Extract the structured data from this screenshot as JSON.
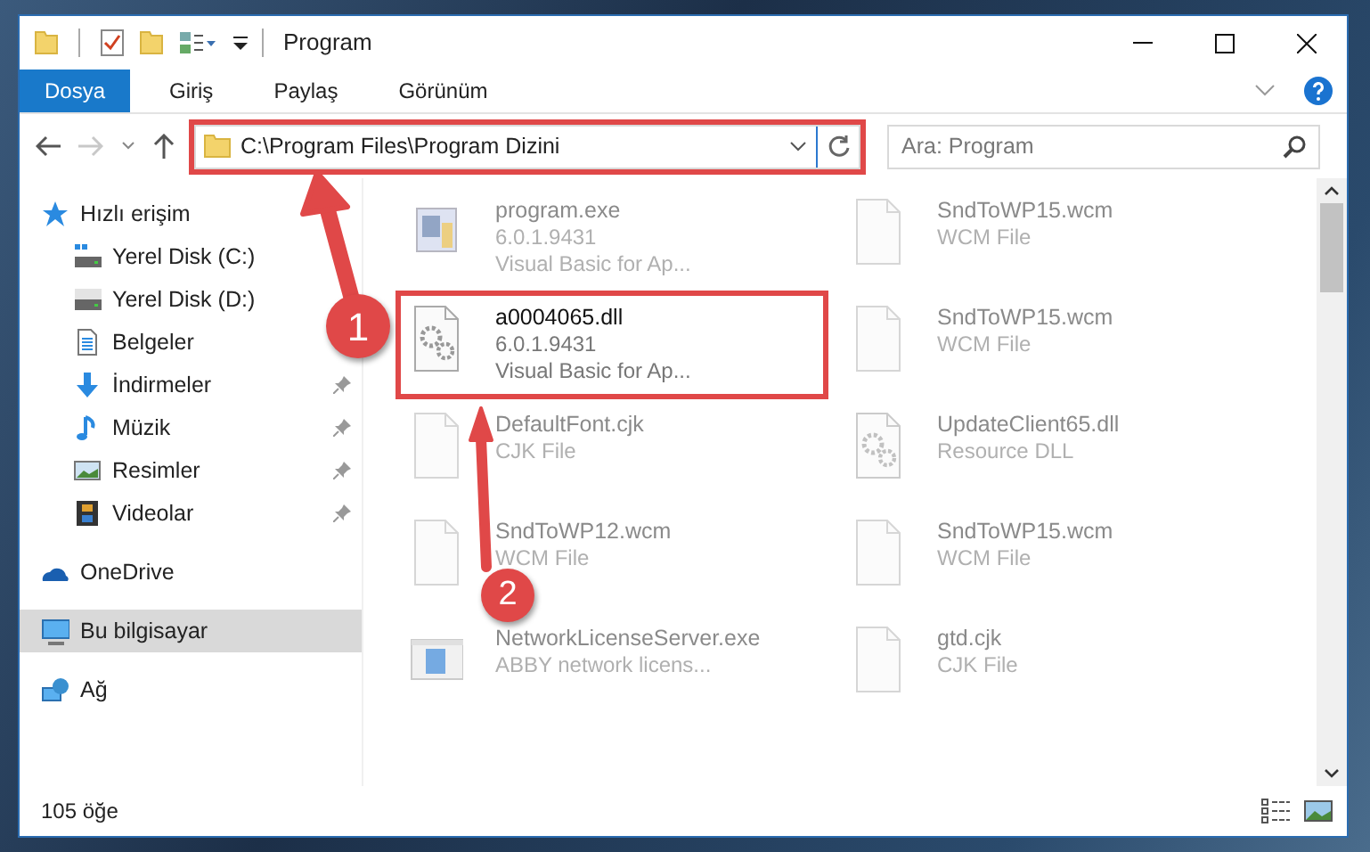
{
  "window": {
    "title": "Program"
  },
  "ribbon_tabs": [
    {
      "label": "Dosya",
      "selected": true
    },
    {
      "label": "Giriş",
      "selected": false
    },
    {
      "label": "Paylaş",
      "selected": false
    },
    {
      "label": "Görünüm",
      "selected": false
    }
  ],
  "address": {
    "path": "C:\\Program Files\\Program Dizini",
    "highlighted": true
  },
  "search": {
    "placeholder": "Ara: Program"
  },
  "sidebar": {
    "items": [
      {
        "label": "Hızlı erişim",
        "kind": "star",
        "selected": false,
        "children": [
          {
            "label": "Yerel Disk (C:)",
            "kind": "drive-c",
            "selected": false
          },
          {
            "label": "Yerel Disk (D:)",
            "kind": "drive",
            "selected": false
          },
          {
            "label": "Belgeler",
            "kind": "document",
            "selected": false
          },
          {
            "label": "İndirmeler",
            "kind": "download",
            "pinned": true,
            "selected": false
          },
          {
            "label": "Müzik",
            "kind": "music",
            "pinned": true,
            "selected": false
          },
          {
            "label": "Resimler",
            "kind": "pictures",
            "pinned": true,
            "selected": false
          },
          {
            "label": "Videolar",
            "kind": "video",
            "pinned": true,
            "selected": false
          }
        ]
      },
      {
        "label": "OneDrive",
        "kind": "cloud",
        "selected": false
      },
      {
        "label": "Bu bilgisayar",
        "kind": "computer",
        "selected": true
      },
      {
        "label": "Ağ",
        "kind": "network",
        "selected": false
      }
    ]
  },
  "files": [
    {
      "name": "program.exe",
      "lines": [
        "6.0.1.9431",
        "Visual Basic for Ap..."
      ],
      "kind": "exe",
      "dimmed": true,
      "highlighted": false
    },
    {
      "name": "SndToWP15.wcm",
      "lines": [
        "WCM File"
      ],
      "kind": "blank",
      "dimmed": true,
      "highlighted": false
    },
    {
      "name": "a0004065.dll",
      "lines": [
        "6.0.1.9431",
        "Visual Basic for Ap..."
      ],
      "kind": "dll",
      "dimmed": false,
      "highlighted": true
    },
    {
      "name": "SndToWP15.wcm",
      "lines": [
        "WCM File"
      ],
      "kind": "blank",
      "dimmed": true,
      "highlighted": false
    },
    {
      "name": "DefaultFont.cjk",
      "lines": [
        "CJK File"
      ],
      "kind": "blank",
      "dimmed": true,
      "highlighted": false
    },
    {
      "name": "UpdateClient65.dll",
      "lines": [
        "Resource DLL"
      ],
      "kind": "dll",
      "dimmed": true,
      "highlighted": false
    },
    {
      "name": "SndToWP12.wcm",
      "lines": [
        "WCM File"
      ],
      "kind": "blank",
      "dimmed": true,
      "highlighted": false
    },
    {
      "name": "SndToWP15.wcm",
      "lines": [
        "WCM File"
      ],
      "kind": "blank",
      "dimmed": true,
      "highlighted": false
    },
    {
      "name": "NetworkLicenseServer.exe",
      "lines": [
        "ABBY network licens..."
      ],
      "kind": "app",
      "dimmed": true,
      "highlighted": false
    },
    {
      "name": "gtd.cjk",
      "lines": [
        "CJK File"
      ],
      "kind": "blank",
      "dimmed": true,
      "highlighted": false
    }
  ],
  "status_bar": {
    "count": "105 öğe"
  },
  "callouts": [
    {
      "number": "1"
    },
    {
      "number": "2"
    }
  ]
}
